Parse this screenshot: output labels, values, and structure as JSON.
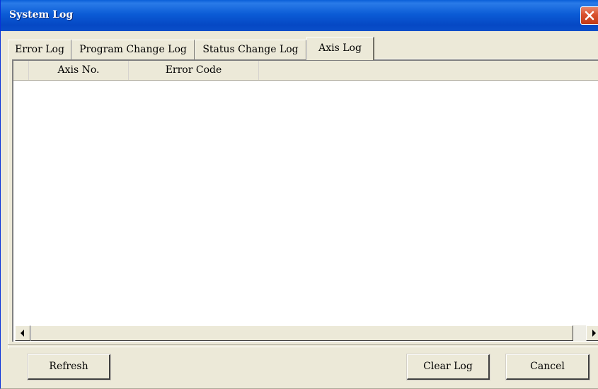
{
  "window": {
    "title": "System Log"
  },
  "tabs": [
    {
      "label": "Error Log",
      "active": false
    },
    {
      "label": "Program Change Log",
      "active": false
    },
    {
      "label": "Status Change Log",
      "active": false
    },
    {
      "label": "Axis Log",
      "active": true
    }
  ],
  "list": {
    "columns": [
      "",
      "Axis No.",
      "Error Code",
      ""
    ],
    "rows": []
  },
  "buttons": {
    "refresh": "Refresh",
    "clear_log": "Clear Log",
    "cancel": "Cancel"
  },
  "icons": {
    "close": "close-icon",
    "scroll_left": "arrow-left-icon",
    "scroll_right": "arrow-right-icon"
  },
  "colors": {
    "titlebar": "#0b5cd6",
    "close_button": "#d9502c",
    "face": "#ece9d8"
  }
}
